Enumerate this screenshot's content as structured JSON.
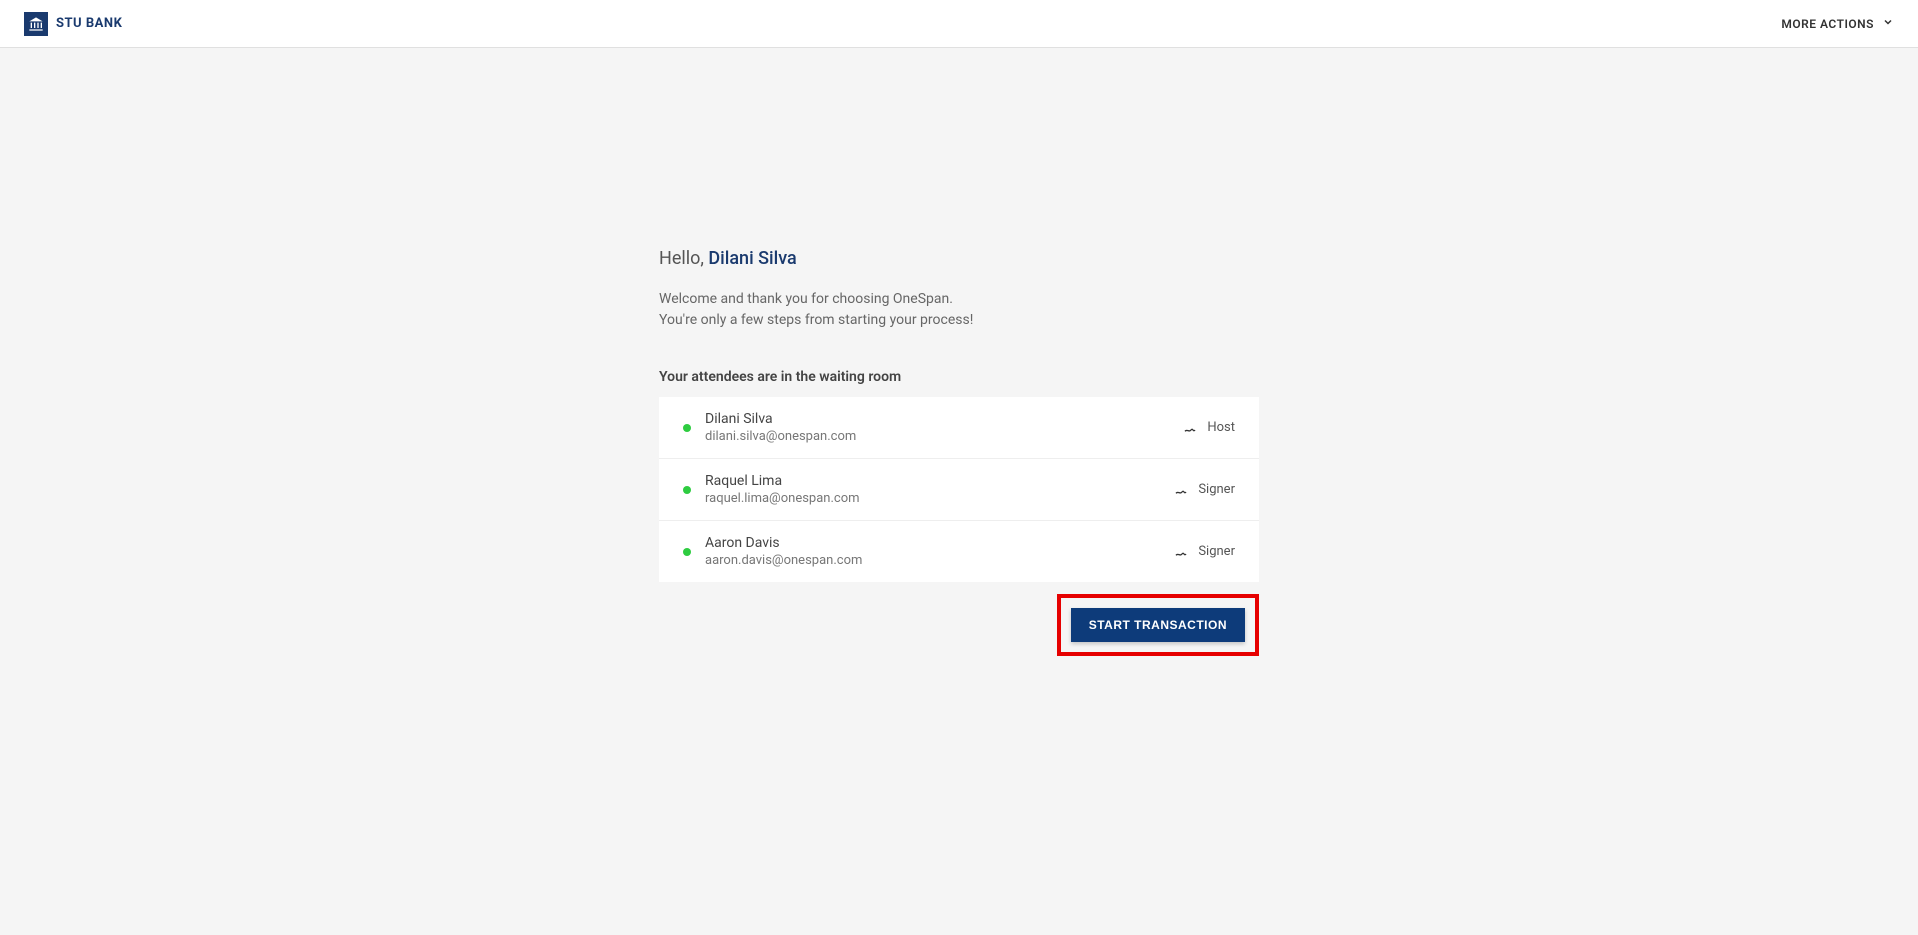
{
  "header": {
    "brand_name": "STU BANK",
    "more_actions_label": "MORE ACTIONS"
  },
  "greeting": {
    "hello": "Hello, ",
    "name": "Dilani Silva"
  },
  "welcome": {
    "line1": "Welcome and thank you for choosing OneSpan.",
    "line2": "You're only a few steps from starting your process!"
  },
  "attendees": {
    "heading": "Your attendees are in the waiting room",
    "list": [
      {
        "name": "Dilani Silva",
        "email": "dilani.silva@onespan.com",
        "role": "Host"
      },
      {
        "name": "Raquel Lima",
        "email": "raquel.lima@onespan.com",
        "role": "Signer"
      },
      {
        "name": "Aaron Davis",
        "email": "aaron.davis@onespan.com",
        "role": "Signer"
      }
    ]
  },
  "actions": {
    "start_transaction_label": "START TRANSACTION"
  }
}
